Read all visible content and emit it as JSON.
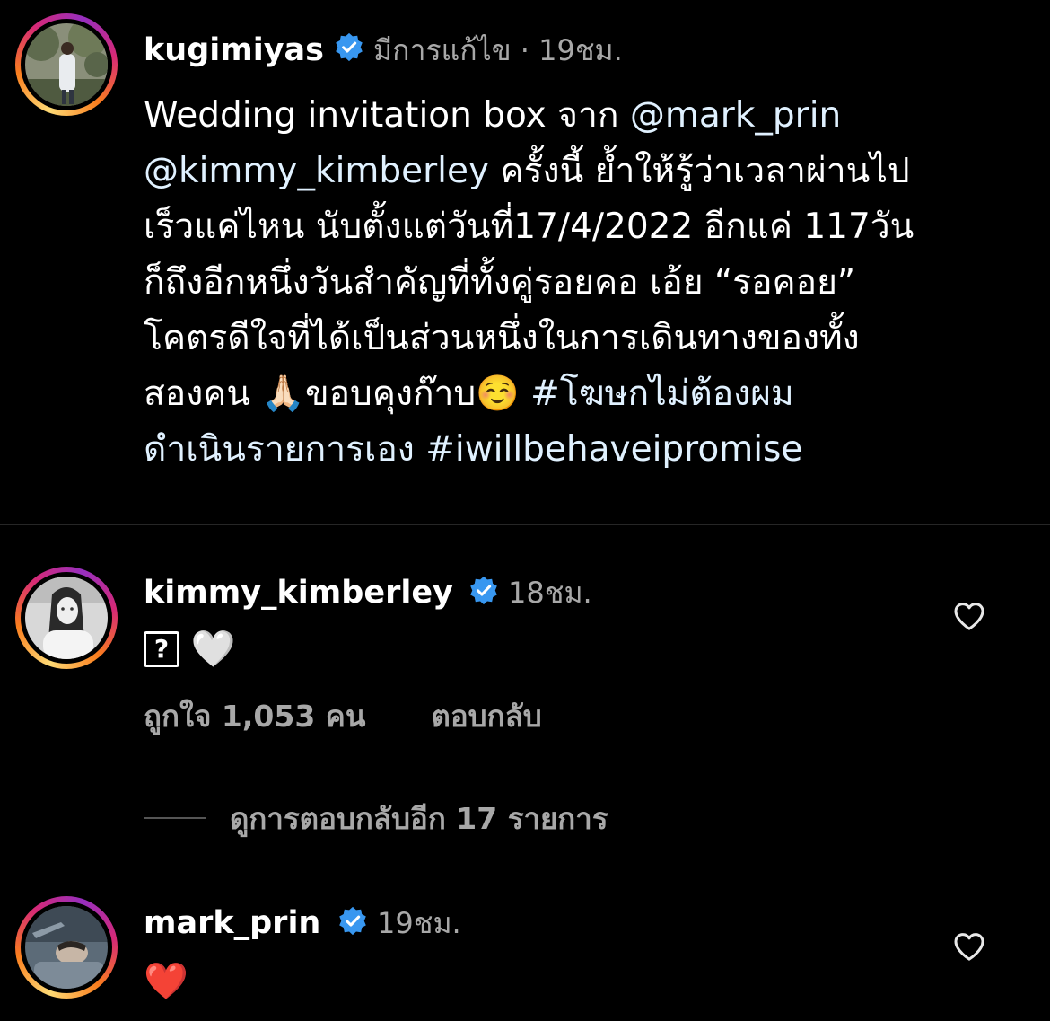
{
  "post": {
    "author": {
      "username": "kugimiyas",
      "verified": true,
      "edited_label": "มีการแก้ไข",
      "separator": "·",
      "time": "19ชม."
    },
    "caption": {
      "lines": [
        [
          {
            "t": "Wedding invitation box จาก "
          },
          {
            "t": "@mark_prin",
            "link": true
          }
        ],
        [
          {
            "t": "@kimmy_kimberley",
            "link": true
          },
          {
            "t": " ครั้งนี้ ย้ำให้รู้ว่าเวลาผ่านไป"
          }
        ],
        [
          {
            "t": "เร็วแค่ไหน นับตั้งแต่วันที่17/4/2022 อีกแค่ 117วัน"
          }
        ],
        [
          {
            "t": "ก็ถึงอีกหนึ่งวันสำคัญที่ทั้งคู่รอยคอ เอ้ย “รอคอย”"
          }
        ],
        [
          {
            "t": "โคตรดีใจที่ได้เป็นส่วนหนึ่งในการเดินทางของทั้ง"
          }
        ],
        [
          {
            "t": "สองคน 🙏🏻ขอบคุงก๊าบ☺️ "
          },
          {
            "t": "#โฆษกไม่ต้องผม",
            "link": true
          }
        ],
        [
          {
            "t": "ดำเนินรายการเอง ",
            "link": true
          },
          {
            "t": "#iwillbehaveipromise",
            "link": true
          }
        ]
      ]
    }
  },
  "comments": [
    {
      "username": "kimmy_kimberley",
      "verified": true,
      "time": "18ชม.",
      "text_box_glyph": "?",
      "text_emoji": "🤍",
      "likes_label": "ถูกใจ 1,053 คน",
      "reply_label": "ตอบกลับ",
      "view_replies_label": "ดูการตอบกลับอีก 17 รายการ",
      "like_icon": "heart-outline-icon"
    },
    {
      "username": "mark_prin",
      "verified": true,
      "time": "19ชม.",
      "text_emoji": "❤️",
      "like_icon": "heart-outline-icon"
    }
  ],
  "colors": {
    "background": "#000000",
    "text": "#ffffff",
    "secondary_text": "#a8a8a8",
    "link": "#e0f1ff",
    "verified_badge": "#3897f0",
    "divider": "#262626"
  }
}
